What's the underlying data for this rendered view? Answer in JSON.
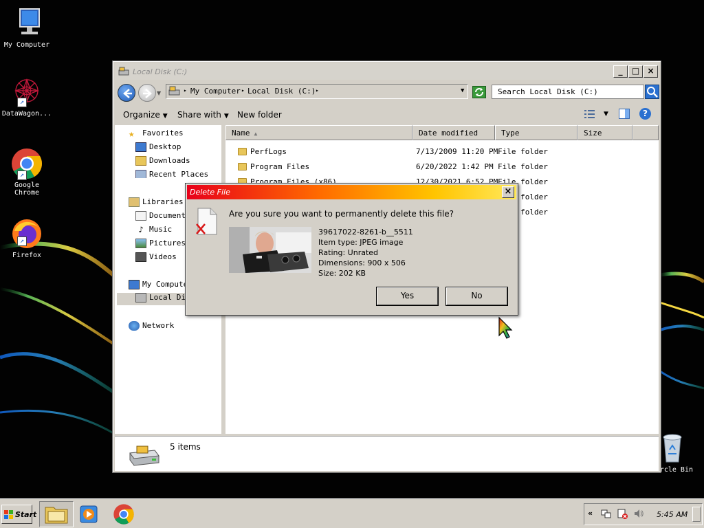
{
  "desktop": {
    "icons": [
      {
        "label": "My Computer",
        "icon": "computer-icon"
      },
      {
        "label": "DataWagon...",
        "icon": "datawagon-icon"
      },
      {
        "label": "Google Chrome",
        "icon": "chrome-icon"
      },
      {
        "label": "Firefox",
        "icon": "firefox-icon"
      },
      {
        "label": "rcle Bin",
        "icon": "recycle-bin-icon"
      }
    ]
  },
  "explorer": {
    "title": "Local Disk (C:)",
    "buttons": {
      "minimize": "_",
      "maximize": "□",
      "close": "×"
    },
    "address": {
      "crumb1": "My Computer",
      "crumb2": "Local Disk (C:)"
    },
    "search": {
      "placeholder": "Search Local Disk (C:)"
    },
    "toolbar": {
      "organize": "Organize",
      "share": "Share with",
      "new_folder": "New folder"
    },
    "nav": {
      "favorites": "Favorites",
      "desktop": "Desktop",
      "downloads": "Downloads",
      "recent": "Recent Places",
      "libraries": "Libraries",
      "documents": "Documents",
      "music": "Music",
      "pictures": "Pictures",
      "videos": "Videos",
      "my_computer": "My Compute",
      "local_disk": "Local Dis",
      "network": "Network"
    },
    "columns": {
      "name": "Name",
      "date": "Date modified",
      "type": "Type",
      "size": "Size"
    },
    "files": [
      {
        "name": "PerfLogs",
        "date": "7/13/2009 11:20 PM",
        "type": "File folder"
      },
      {
        "name": "Program Files",
        "date": "6/20/2022 1:42 PM",
        "type": "File folder"
      },
      {
        "name": "Program Files (x86)",
        "date": "12/30/2021 6:52 PM",
        "type": "File folder"
      },
      {
        "name": "",
        "date": "",
        "type": "File folder"
      },
      {
        "name": "",
        "date": "",
        "type": "File folder"
      }
    ],
    "status": {
      "items": "5 items"
    }
  },
  "dialog": {
    "title": "Delete File",
    "close": "×",
    "question": "Are you sure you want to permanently delete this file?",
    "file_name": "39617022-8261-b__5511",
    "item_type": "Item type: JPEG image",
    "rating": "Rating: Unrated",
    "dimensions": "Dimensions: 900 x 506",
    "size": "Size: 202 KB",
    "yes": "Yes",
    "no": "No"
  },
  "taskbar": {
    "start": "Start",
    "clock": "5:45 AM",
    "tray_expand": "«"
  },
  "colors": {
    "dialog_title_gradient": [
      "#e8001a",
      "#ff6a00",
      "#ffc400",
      "#ffe85a"
    ],
    "window_face": "#d4d0c8"
  }
}
